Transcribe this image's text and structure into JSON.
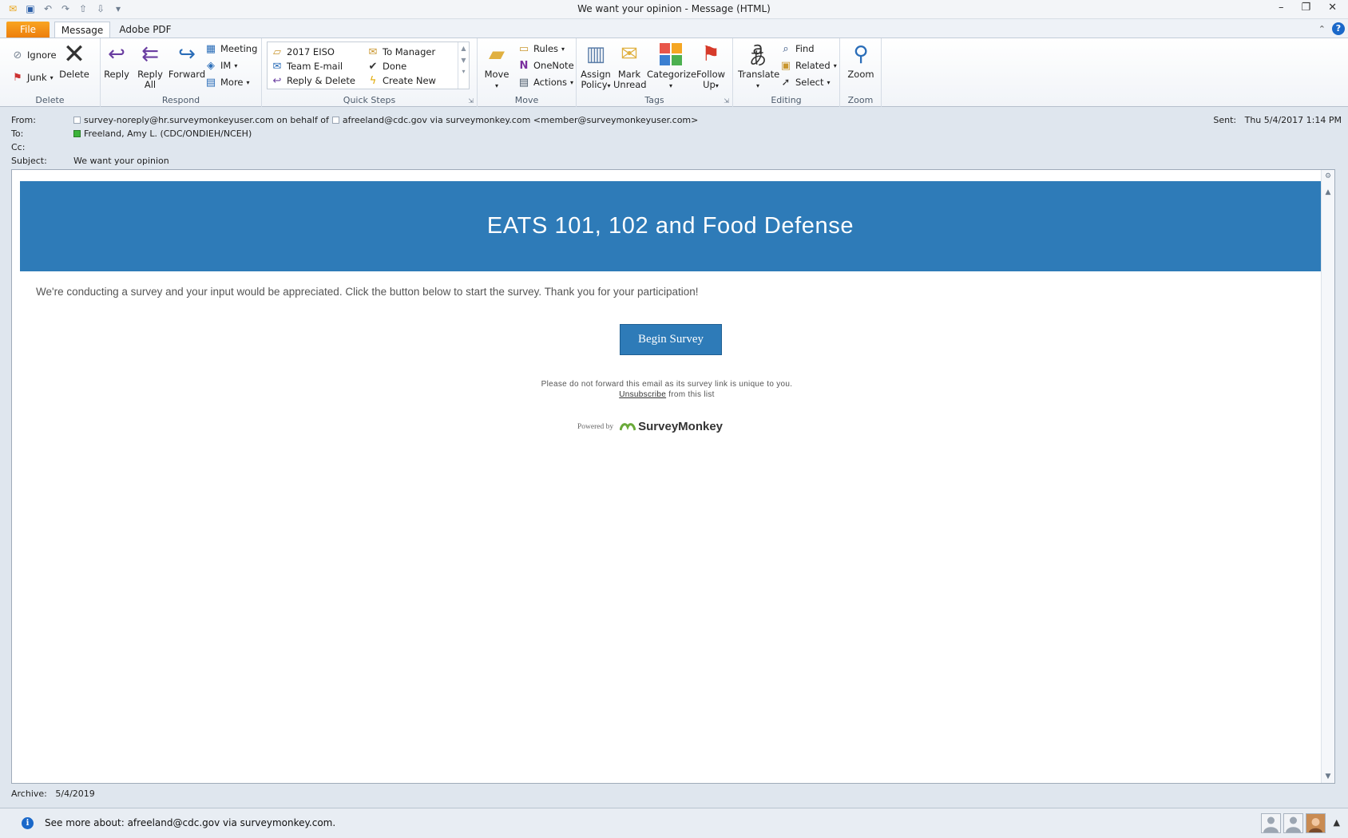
{
  "window": {
    "title": "We want your opinion  -  Message (HTML)",
    "controls": {
      "minimize": "–",
      "restore": "❐",
      "close": "✕"
    }
  },
  "qat_icons": [
    "outlook-icon",
    "save-icon",
    "undo-icon",
    "redo-icon",
    "up-icon",
    "down-icon",
    "customize-icon"
  ],
  "tabs": {
    "file": "File",
    "message": "Message",
    "adobe_pdf": "Adobe PDF"
  },
  "ribbon": {
    "delete_group": {
      "label": "Delete",
      "ignore": "Ignore",
      "junk": "Junk",
      "delete": "Delete"
    },
    "respond_group": {
      "label": "Respond",
      "reply": "Reply",
      "reply_all_1": "Reply",
      "reply_all_2": "All",
      "forward": "Forward",
      "meeting": "Meeting",
      "im": "IM",
      "more": "More"
    },
    "quicksteps_group": {
      "label": "Quick Steps",
      "items": [
        "2017 EISO",
        "To Manager",
        "Team E-mail",
        "Done",
        "Reply & Delete",
        "Create New"
      ]
    },
    "move_group": {
      "label": "Move",
      "move": "Move",
      "rules": "Rules",
      "onenote": "OneNote",
      "actions": "Actions"
    },
    "tags_group": {
      "label": "Tags",
      "assign_1": "Assign",
      "assign_2": "Policy",
      "mark_1": "Mark",
      "mark_2": "Unread",
      "categorize": "Categorize",
      "follow_1": "Follow",
      "follow_2": "Up"
    },
    "editing_group": {
      "label": "Editing",
      "translate": "Translate",
      "find": "Find",
      "related": "Related",
      "select": "Select"
    },
    "zoom_group": {
      "label": "Zoom",
      "zoom": "Zoom"
    }
  },
  "header": {
    "from_label": "From:",
    "from_value": "survey-noreply@hr.surveymonkeyuser.com on behalf of",
    "from_value2": "afreeland@cdc.gov via surveymonkey.com <member@surveymonkeyuser.com>",
    "to_label": "To:",
    "to_value": "Freeland, Amy L. (CDC/ONDIEH/NCEH)",
    "cc_label": "Cc:",
    "subject_label": "Subject:",
    "subject_value": "We want your opinion",
    "sent_label": "Sent:",
    "sent_value": "Thu 5/4/2017 1:14 PM"
  },
  "email": {
    "banner_title": "EATS 101, 102 and Food Defense",
    "intro": "We're conducting a survey and your input would be appreciated. Click the button below to start the survey. Thank you for your participation!",
    "button": "Begin Survey",
    "notice": "Please do not forward this email as its survey link is unique to you.",
    "unsubscribe": "Unsubscribe",
    "unsubscribe_tail": "from this list",
    "powered_by": "Powered by",
    "brand": "SurveyMonkey",
    "brand_color": "#2e7bb8"
  },
  "footer": {
    "archive_label": "Archive:",
    "archive_value": "5/4/2019",
    "see_more": "See more about: afreeland@cdc.gov via surveymonkey.com."
  }
}
